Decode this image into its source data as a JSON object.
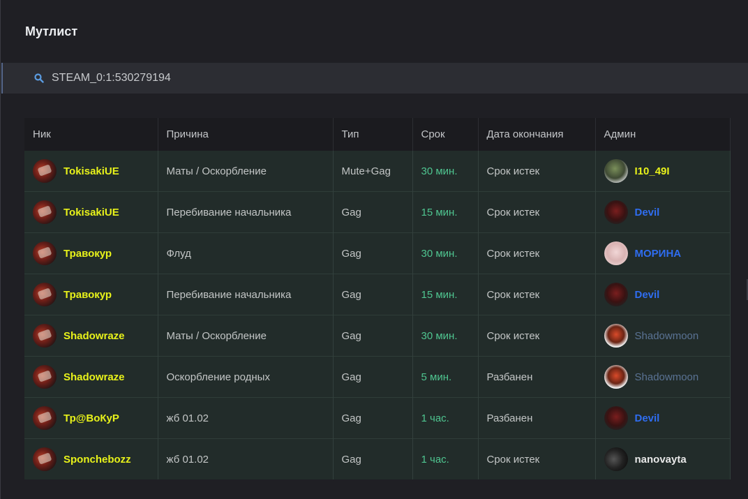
{
  "page": {
    "title": "Мутлист"
  },
  "search": {
    "value": "STEAM_0:1:530279194",
    "icon": "search-icon"
  },
  "colors": {
    "background": "#1f1f24",
    "row_background": "#222c2a",
    "nick_color": "#e8f21a",
    "term_color": "#4fc590"
  },
  "table": {
    "headers": [
      "Ник",
      "Причина",
      "Тип",
      "Срок",
      "Дата окончания",
      "Админ"
    ],
    "rows": [
      {
        "nick": "TokisakiUE",
        "reason": "Маты / Оскорбление",
        "type": "Mute+Gag",
        "term": "30 мин.",
        "end_date": "Срок истек",
        "admin": "I10_49I",
        "admin_color": "#e8f21a",
        "admin_avatar": "av-green"
      },
      {
        "nick": "TokisakiUE",
        "reason": "Перебивание начальника",
        "type": "Gag",
        "term": "15 мин.",
        "end_date": "Срок истек",
        "admin": "Devil",
        "admin_color": "#2f6df0",
        "admin_avatar": "av-devil"
      },
      {
        "nick": "Травокур",
        "reason": "Флуд",
        "type": "Gag",
        "term": "30 мин.",
        "end_date": "Срок истек",
        "admin": "МОРИНА",
        "admin_color": "#2f6df0",
        "admin_avatar": "av-morina"
      },
      {
        "nick": "Травокур",
        "reason": "Перебивание начальника",
        "type": "Gag",
        "term": "15 мин.",
        "end_date": "Срок истек",
        "admin": "Devil",
        "admin_color": "#2f6df0",
        "admin_avatar": "av-devil"
      },
      {
        "nick": "Shadowraze",
        "reason": "Маты / Оскорбление",
        "type": "Gag",
        "term": "30 мин.",
        "end_date": "Срок истек",
        "admin": "Shadowmoon",
        "admin_color": "#5a7394",
        "admin_avatar": "av-shadow"
      },
      {
        "nick": "Shadowraze",
        "reason": "Оскорбление родных",
        "type": "Gag",
        "term": "5 мин.",
        "end_date": "Разбанен",
        "admin": "Shadowmoon",
        "admin_color": "#5a7394",
        "admin_avatar": "av-shadow"
      },
      {
        "nick": "Тр@ВоКуР",
        "reason": "жб 01.02",
        "type": "Gag",
        "term": "1 час.",
        "end_date": "Разбанен",
        "admin": "Devil",
        "admin_color": "#2f6df0",
        "admin_avatar": "av-devil"
      },
      {
        "nick": "Sponchebozz",
        "reason": "жб 01.02",
        "type": "Gag",
        "term": "1 час.",
        "end_date": "Срок истек",
        "admin": "nanovayta",
        "admin_color": "#e8e8e8",
        "admin_avatar": "av-nano"
      }
    ]
  }
}
